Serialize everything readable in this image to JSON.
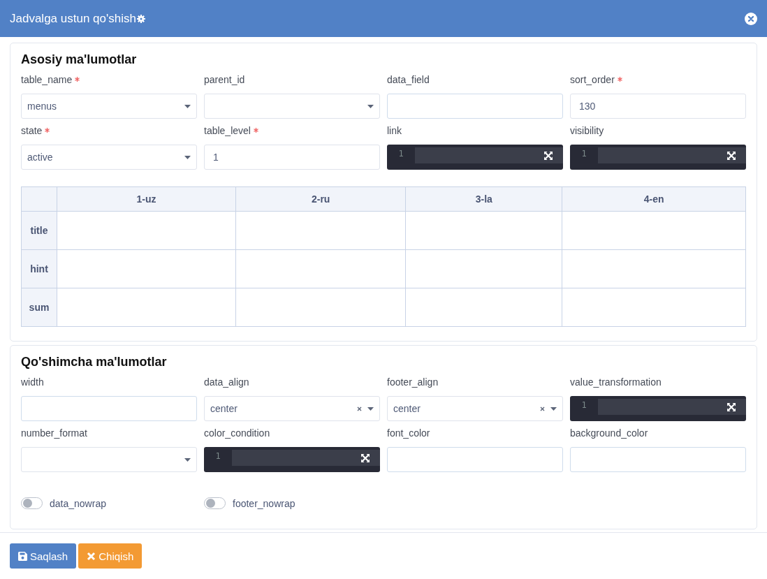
{
  "window": {
    "title": "Jadvalga ustun qo'shish"
  },
  "sections": [
    {
      "title": "Asosiy ma'lumotlar",
      "fields": [
        {
          "label": "table_name",
          "required": true,
          "kind": "select",
          "value": "menus"
        },
        {
          "label": "parent_id",
          "required": false,
          "kind": "select"
        },
        {
          "label": "data_field",
          "required": false,
          "kind": "input"
        },
        {
          "label": "sort_order",
          "required": true,
          "kind": "input",
          "value": "130"
        },
        {
          "label": "state",
          "required": true,
          "kind": "select",
          "value": "active"
        },
        {
          "label": "table_level",
          "required": true,
          "kind": "input",
          "value": "1"
        },
        {
          "label": "link",
          "required": false,
          "kind": "code",
          "line_number": "1"
        },
        {
          "label": "visibility",
          "required": false,
          "kind": "code",
          "line_number": "1"
        }
      ],
      "table": {
        "columns": [
          "1-uz",
          "2-ru",
          "3-la",
          "4-en"
        ],
        "rows": [
          "title",
          "hint",
          "sum"
        ]
      }
    },
    {
      "title": "Qo'shimcha ma'lumotlar",
      "fields": [
        {
          "label": "width",
          "required": false,
          "kind": "input"
        },
        {
          "label": "data_align",
          "required": false,
          "kind": "select",
          "value": "center",
          "clearable": true
        },
        {
          "label": "footer_align",
          "required": false,
          "kind": "select",
          "value": "center",
          "clearable": true
        },
        {
          "label": "value_transformation",
          "required": false,
          "kind": "code",
          "line_number": "1"
        },
        {
          "label": "number_format",
          "required": false,
          "kind": "select"
        },
        {
          "label": "color_condition",
          "required": false,
          "kind": "code",
          "line_number": "1"
        },
        {
          "label": "font_color",
          "required": false,
          "kind": "input"
        },
        {
          "label": "background_color",
          "required": false,
          "kind": "input"
        }
      ],
      "toggles": [
        {
          "label": "data_nowrap",
          "on": false
        },
        {
          "label": "footer_nowrap",
          "on": false
        }
      ]
    }
  ],
  "buttons": [
    {
      "label": "Saqlash",
      "kind": "save"
    },
    {
      "label": "Chiqish",
      "kind": "exit"
    }
  ]
}
